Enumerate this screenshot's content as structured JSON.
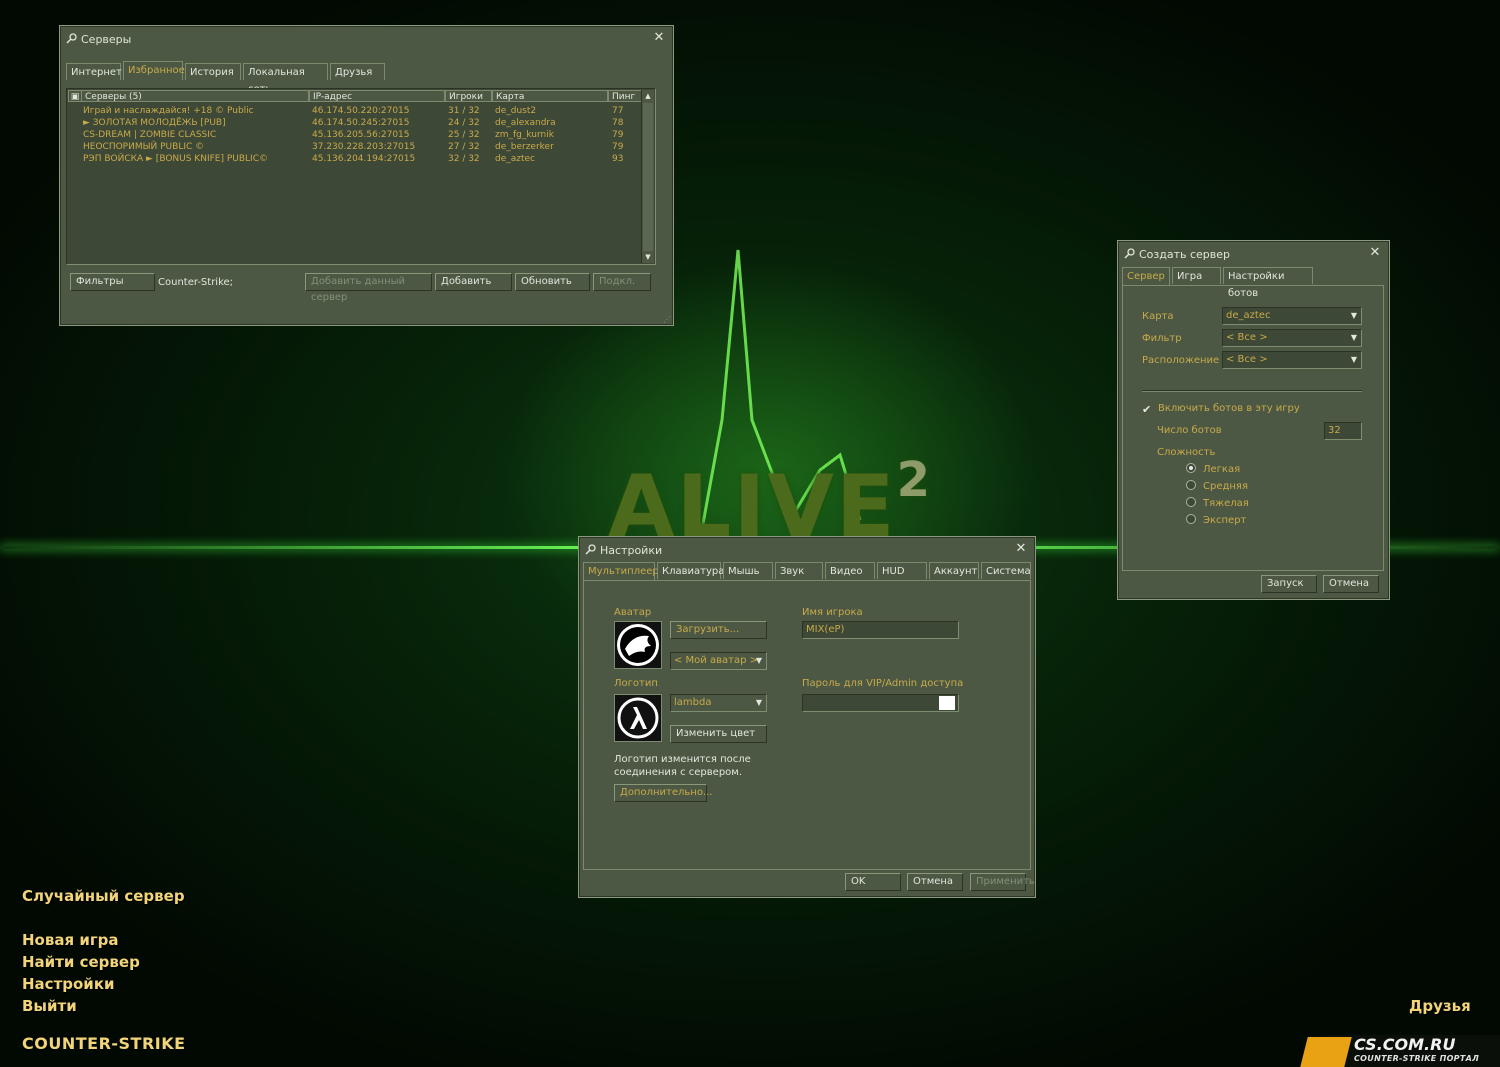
{
  "background": {
    "logo_text": "ALIVE",
    "logo_sup": "2"
  },
  "servers_window": {
    "title": "Серверы",
    "tabs": [
      "Интернет",
      "Избранное",
      "История",
      "Локальная сеть",
      "Друзья"
    ],
    "active_tab": "Избранное",
    "columns": {
      "name": "Серверы (5)",
      "ip": "IP-адрес",
      "players": "Игроки",
      "map": "Карта",
      "ping": "Пинг"
    },
    "rows": [
      {
        "name": "Играй и наслаждайся! +18 © Public",
        "ip": "46.174.50.220:27015",
        "players": "31 / 32",
        "map": "de_dust2",
        "ping": "77"
      },
      {
        "name": "► ЗОЛОТАЯ МОЛОДЁЖЬ [PUB]",
        "ip": "46.174.50.245:27015",
        "players": "24 / 32",
        "map": "de_alexandra",
        "ping": "78"
      },
      {
        "name": "CS-DREAM | ZOMBIE CLASSIC",
        "ip": "45.136.205.56:27015",
        "players": "25 / 32",
        "map": "zm_fg_kurnik",
        "ping": "79"
      },
      {
        "name": "НЕОСПОРИМЫЙ PUBLIC ©",
        "ip": "37.230.228.203:27015",
        "players": "27 / 32",
        "map": "de_berzerker",
        "ping": "79"
      },
      {
        "name": "РЭП ВОЙСКА ► [BONUS KNIFE] PUBLIC©",
        "ip": "45.136.204.194:27015",
        "players": "32 / 32",
        "map": "de_aztec",
        "ping": "93"
      }
    ],
    "filters_label": "Фильтры",
    "game_filter": "Counter-Strike;",
    "add_current_label": "Добавить данный сервер",
    "add_label": "Добавить",
    "refresh_label": "Обновить",
    "connect_label": "Подкл."
  },
  "create_server_window": {
    "title": "Создать сервер",
    "tabs": [
      "Сервер",
      "Игра",
      "Настройки ботов"
    ],
    "active_tab": "Сервер",
    "map_label": "Карта",
    "map_value": "de_aztec",
    "filter_label": "Фильтр",
    "filter_value": "< Все >",
    "location_label": "Расположение",
    "location_value": "< Все >",
    "enable_bots_label": "Включить ботов в эту игру",
    "enable_bots_checked": true,
    "bot_count_label": "Число ботов",
    "bot_count_value": "32",
    "difficulty_label": "Сложность",
    "difficulties": [
      "Легкая",
      "Средняя",
      "Тяжелая",
      "Эксперт"
    ],
    "selected_difficulty": "Легкая",
    "start_label": "Запуск",
    "cancel_label": "Отмена"
  },
  "settings_window": {
    "title": "Настройки",
    "tabs": [
      "Мультиплеер",
      "Клавиатура",
      "Мышь",
      "Звук",
      "Видео",
      "HUD",
      "Аккаунт",
      "Система"
    ],
    "active_tab": "Мультиплеер",
    "avatar_label": "Аватар",
    "load_label": "Загрузить...",
    "avatar_select": "< Мой аватар >",
    "logo_label": "Логотип",
    "logo_select": "lambda",
    "change_color_label": "Изменить цвет",
    "logo_note": "Логотип изменится после соединения с сервером.",
    "advanced_label": "Дополнительно...",
    "player_name_label": "Имя игрока",
    "player_name_value": "MIX(eP)",
    "vip_password_label": "Пароль для VIP/Admin доступа",
    "vip_password_value": "",
    "ok_label": "OK",
    "cancel_label": "Отмена",
    "apply_label": "Применить"
  },
  "main_menu": {
    "items": [
      "Случайный сервер",
      "Новая игра",
      "Найти сервер",
      "Настройки",
      "Выйти"
    ],
    "friends_label": "Друзья",
    "game_logo": "COUNTER-STRIKE",
    "portal_site": "CS.COM.RU",
    "portal_sub": "COUNTER-STRIKE ПОРТАЛ"
  }
}
